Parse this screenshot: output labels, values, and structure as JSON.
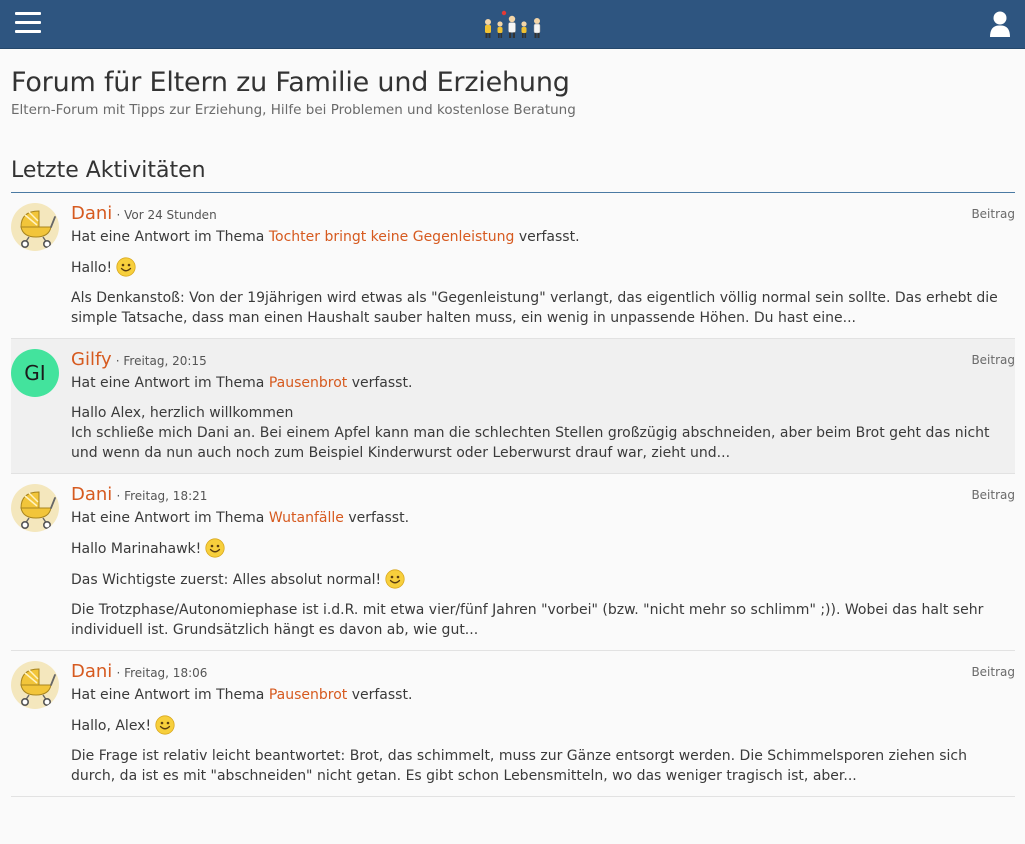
{
  "header": {
    "menu_icon": "hamburger-icon",
    "logo_icon": "family-logo-icon",
    "user_icon": "user-icon",
    "brand_color": "#2e5580"
  },
  "page": {
    "title": "Forum für Eltern zu Familie und Erziehung",
    "subtitle": "Eltern-Forum mit Tipps zur Erziehung, Hilfe bei Problemen und kostenlose Beratung",
    "section_title": "Letzte Aktivitäten"
  },
  "activities": [
    {
      "user": "Dani",
      "time": "· Vor 24 Stunden",
      "type": "Beitrag",
      "action_prefix": "Hat eine Antwort im Thema ",
      "thread": "Tochter bringt keine Gegenleistung",
      "action_suffix": " verfasst.",
      "greeting": "Hallo!",
      "paragraph": "Als Denkanstoß: Von der 19jährigen wird etwas als \"Gegenleistung\" verlangt, das eigentlich völlig normal sein sollte. Das erhebt die simple Tatsache, dass man einen Haushalt sauber halten muss, ein wenig in unpassende Höhen. Du hast eine..."
    },
    {
      "user": "Gilfy",
      "avatar_initials": "GI",
      "time": "· Freitag, 20:15",
      "type": "Beitrag",
      "action_prefix": "Hat eine Antwort im Thema ",
      "thread": "Pausenbrot",
      "action_suffix": " verfasst.",
      "line1": "Hallo Alex, herzlich willkommen",
      "line2": "Ich schließe mich Dani an. Bei einem Apfel kann man die schlechten Stellen großzügig abschneiden, aber beim Brot geht das nicht und wenn da nun auch noch zum Beispiel Kinderwurst oder Leberwurst drauf war, zieht und..."
    },
    {
      "user": "Dani",
      "time": "· Freitag, 18:21",
      "type": "Beitrag",
      "action_prefix": "Hat eine Antwort im Thema ",
      "thread": "Wutanfälle",
      "action_suffix": " verfasst.",
      "greeting": "Hallo Marinahawk!",
      "line2": "Das Wichtigste zuerst: Alles absolut normal!",
      "paragraph": "Die Trotzphase/Autonomiephase ist i.d.R. mit etwa vier/fünf Jahren \"vorbei\" (bzw. \"nicht mehr so schlimm\" ;)). Wobei das halt sehr individuell ist. Grundsätzlich hängt es davon ab, wie gut..."
    },
    {
      "user": "Dani",
      "time": "· Freitag, 18:06",
      "type": "Beitrag",
      "action_prefix": "Hat eine Antwort im Thema ",
      "thread": "Pausenbrot",
      "action_suffix": " verfasst.",
      "greeting": "Hallo, Alex!",
      "paragraph": "Die Frage ist relativ leicht beantwortet: Brot, das schimmelt, muss zur Gänze entsorgt werden. Die Schimmelsporen ziehen sich durch, da ist es mit \"abschneiden\" nicht getan. Es gibt schon Lebensmitteln, wo das weniger tragisch ist, aber..."
    }
  ]
}
